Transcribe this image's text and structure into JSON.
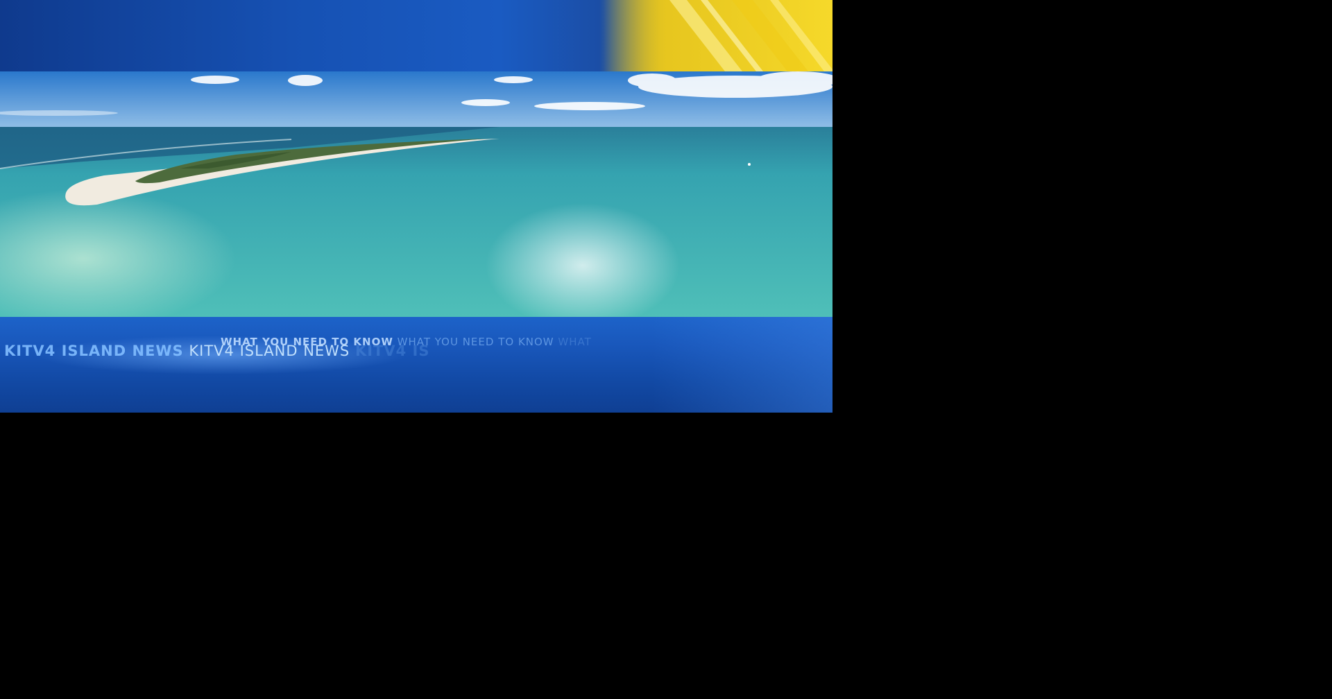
{
  "colors": {
    "band_blue": "#1651b3",
    "accent_yellow": "#f2d21e",
    "sea_turquoise": "#3fb3b6",
    "sky_blue": "#2d7fd0",
    "background": "#000000"
  },
  "ticker": {
    "tagline_bold": "WHAT YOU NEED TO KNOW",
    "tagline_repeat": "WHAT YOU NEED TO KNOW",
    "tagline_fade": "WHAT",
    "brand_strong": "KITV4 ISLAND NEWS",
    "brand_light": "KITV4 ISLAND NEWS",
    "brand_fade": "KITV4 IS"
  }
}
